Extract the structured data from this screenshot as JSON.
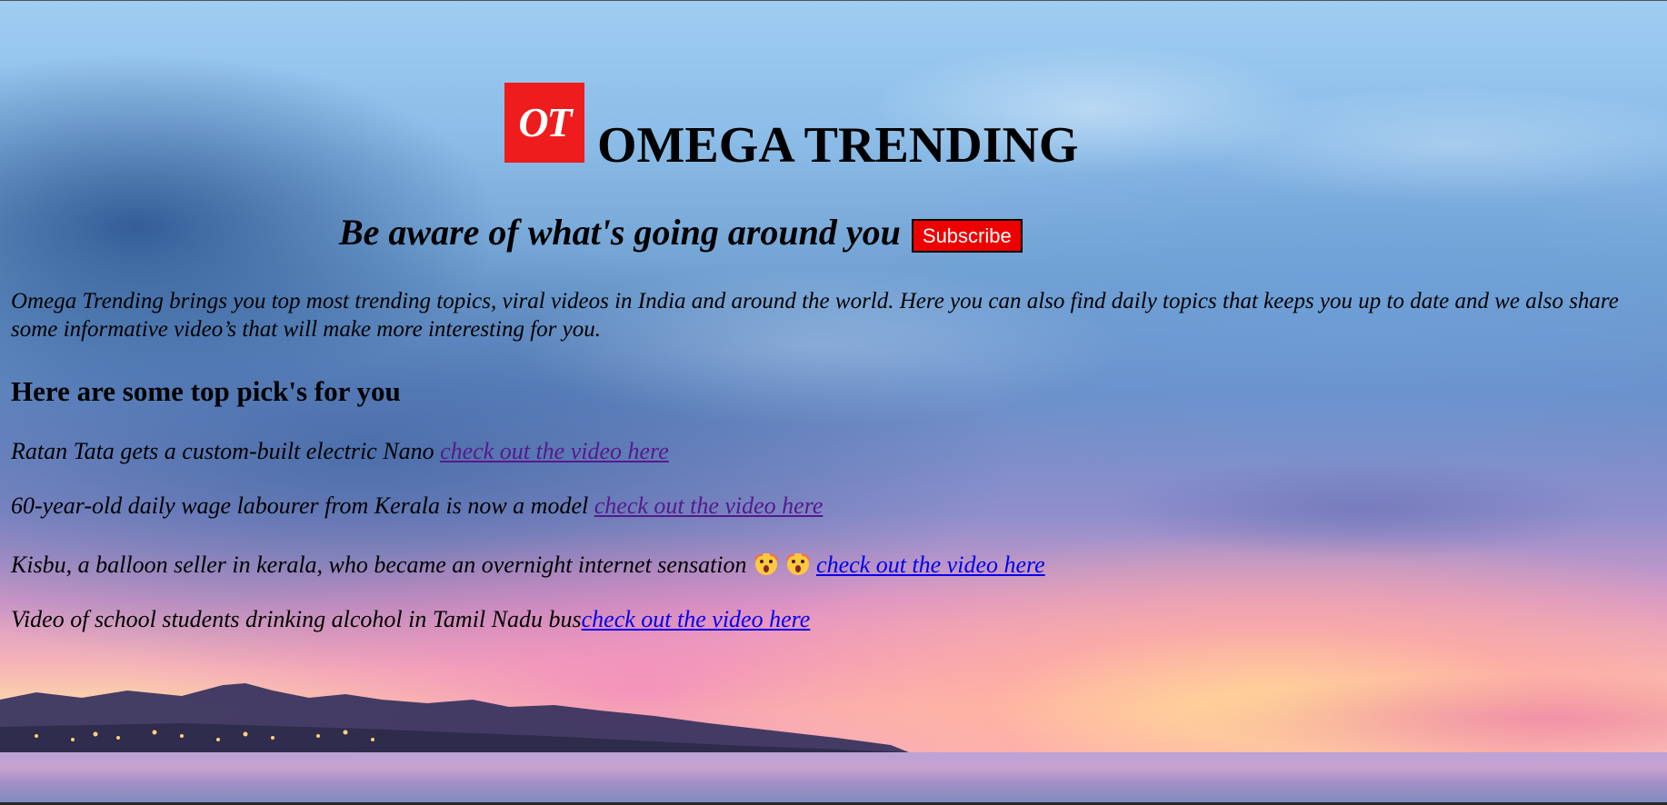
{
  "header": {
    "logo_text": "OT",
    "logo_color": "#ee1c1c",
    "site_title": "OMEGA TRENDING",
    "tagline": "Be aware of what's going around you",
    "subscribe_label": "Subscribe",
    "subscribe_color": "#ee0000"
  },
  "intro": {
    "text": "Omega Trending brings you top most trending topics, viral videos in India and around the world. Here you can also find daily topics that keeps you up to date and we also share some informative video’s that will make more interesting for you."
  },
  "picks": {
    "heading": "Here are some top pick's for you",
    "items": [
      {
        "text": "Ratan Tata gets a custom-built electric Nano ",
        "link": "check out the video here",
        "visited": true
      },
      {
        "text": "60-year-old daily wage labourer from Kerala is now a model ",
        "link": "check out the video here",
        "visited": true
      },
      {
        "text": "Kisbu, a balloon seller in kerala, who became an overnight internet sensation ",
        "emoji": "astonished-face-icon",
        "link": "check out the video here",
        "visited": false
      },
      {
        "text": "Video of school students drinking alcohol in Tamil Nadu bus",
        "link": "check out the video here",
        "visited": false
      }
    ]
  },
  "colors": {
    "visited_link": "#551a8b",
    "link": "#0000ee"
  }
}
